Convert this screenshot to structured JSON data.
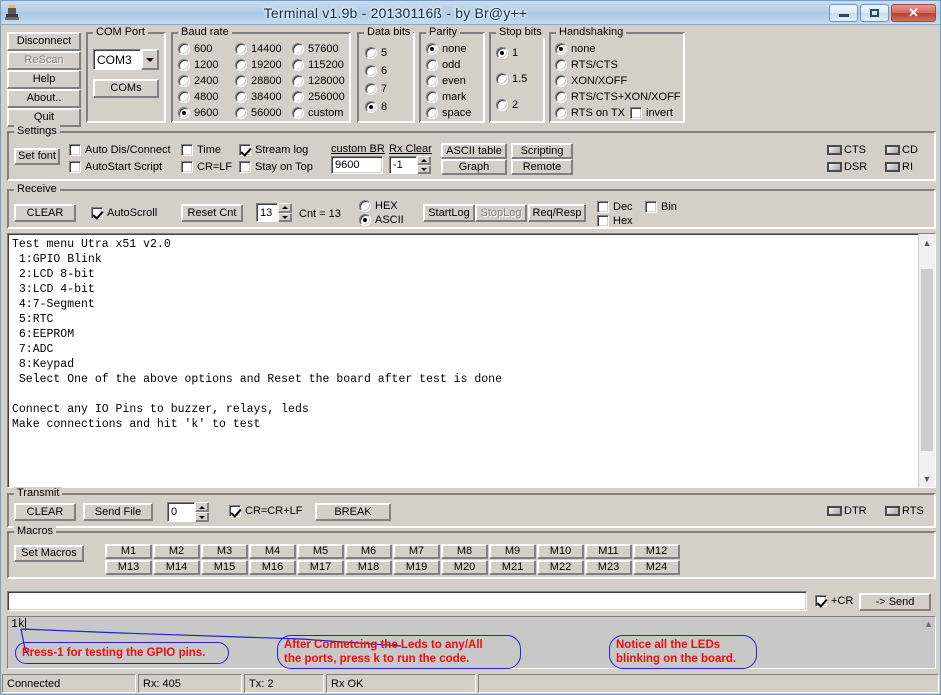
{
  "window": {
    "title": "Terminal v1.9b - 20130116ß - by Br@y++",
    "icon": "terminal-app-icon",
    "minimize_label": "Minimize",
    "maximize_label": "Maximize",
    "close_label": "Close"
  },
  "connection_buttons": [
    {
      "label": "Disconnect",
      "accel": "",
      "disabled": false
    },
    {
      "label": "ReScan",
      "accel": "R",
      "disabled": true
    },
    {
      "label": "Help",
      "accel": "H",
      "disabled": false
    },
    {
      "label": "About..",
      "accel": "A",
      "disabled": false
    },
    {
      "label": "Quit",
      "accel": "Q",
      "disabled": false
    }
  ],
  "com_port": {
    "legend": "COM Port",
    "selected": "COM3",
    "coms_button": "COMs"
  },
  "baud_rate": {
    "legend": "Baud rate",
    "selected": "9600",
    "col1": [
      "600",
      "1200",
      "2400",
      "4800",
      "9600"
    ],
    "col2": [
      "14400",
      "19200",
      "28800",
      "38400",
      "56000"
    ],
    "col3": [
      "57600",
      "115200",
      "128000",
      "256000",
      "custom"
    ]
  },
  "data_bits": {
    "legend": "Data bits",
    "selected": "8",
    "options": [
      "5",
      "6",
      "7",
      "8"
    ]
  },
  "parity": {
    "legend": "Parity",
    "selected": "none",
    "options": [
      "none",
      "odd",
      "even",
      "mark",
      "space"
    ]
  },
  "stop_bits": {
    "legend": "Stop bits",
    "selected": "1",
    "options": [
      "1",
      "1.5",
      "2"
    ]
  },
  "handshaking": {
    "legend": "Handshaking",
    "selected": "none",
    "options": [
      "none",
      "RTS/CTS",
      "XON/XOFF",
      "RTS/CTS+XON/XOFF",
      "RTS on TX"
    ],
    "invert_label": "invert",
    "invert_checked": false
  },
  "settings": {
    "legend": "Settings",
    "set_font_button": "Set font",
    "checks": [
      {
        "label": "Auto Dis/Connect",
        "checked": false
      },
      {
        "label": "AutoStart Script",
        "checked": false
      },
      {
        "label": "Time",
        "checked": false
      },
      {
        "label": "CR=LF",
        "checked": false
      },
      {
        "label": "Stream log",
        "checked": true
      },
      {
        "label": "Stay on Top",
        "checked": false
      }
    ],
    "custom_br_label": "custom BR",
    "custom_br_value": "9600",
    "rx_clear_label": "Rx Clear",
    "rx_clear_value": "-1",
    "ascii_table_button": "ASCII table",
    "graph_button": "Graph",
    "scripting_button": "Scripting",
    "remote_button": "Remote",
    "leds": [
      "CTS",
      "CD",
      "DSR",
      "RI"
    ]
  },
  "receive": {
    "legend": "Receive",
    "clear_button": "CLEAR",
    "autoscroll_label": "AutoScroll",
    "autoscroll_checked": true,
    "reset_cnt_button": "Reset Cnt",
    "cnt_spin_value": "13",
    "cnt_label": "Cnt = 13",
    "hex_label": "HEX",
    "ascii_label": "ASCII",
    "mode_selected": "ASCII",
    "startlog_button": "StartLog",
    "stoplog_button": "StopLog",
    "stoplog_disabled": true,
    "reqresp_button": "Req/Resp",
    "dec_label": "Dec",
    "hex_check_label": "Hex",
    "bin_label": "Bin",
    "dec_checked": false,
    "hex_checked": false,
    "bin_checked": false,
    "terminal_text": "Test menu Utra x51 v2.0\n 1:GPIO Blink\n 2:LCD 8-bit\n 3:LCD 4-bit\n 4:7-Segment\n 5:RTC\n 6:EEPROM\n 7:ADC\n 8:Keypad\n Select One of the above options and Reset the board after test is done\n\nConnect any IO Pins to buzzer, relays, leds\nMake connections and hit 'k' to test"
  },
  "transmit": {
    "legend": "Transmit",
    "clear_button": "CLEAR",
    "send_file_button": "Send File",
    "delay_value": "0",
    "crlf_label": "CR=CR+LF",
    "crlf_checked": true,
    "break_button": "BREAK",
    "leds": [
      "DTR",
      "RTS"
    ]
  },
  "macros": {
    "legend": "Macros",
    "set_macros_button": "Set Macros",
    "row1": [
      "M1",
      "M2",
      "M3",
      "M4",
      "M5",
      "M6",
      "M7",
      "M8",
      "M9",
      "M10",
      "M11",
      "M12"
    ],
    "row2": [
      "M13",
      "M14",
      "M15",
      "M16",
      "M17",
      "M18",
      "M19",
      "M20",
      "M21",
      "M22",
      "M23",
      "M24"
    ]
  },
  "send_bar": {
    "input_value": "",
    "input_placeholder": "",
    "cr_label": "+CR",
    "cr_checked": true,
    "send_button": "-> Send"
  },
  "transmit_log": {
    "text": "1k"
  },
  "annotations": [
    {
      "text": "Press-1 for testing the GPIO pins.",
      "color": "#e8100f"
    },
    {
      "text": "After Connetcing the Leds to any/All\nthe ports, press k to run the code.",
      "color": "#e8100f"
    },
    {
      "text": "Notice all the LEDs\nblinking on the board.",
      "color": "#e8100f"
    }
  ],
  "status_bar": {
    "connection": "Connected",
    "rx": "Rx: 405",
    "tx": "Tx: 2",
    "rx_state": "Rx OK",
    "extra": ""
  },
  "colors": {
    "face": "#d4d0c8",
    "annotation_text": "#e8100f",
    "annotation_outline": "#2323c8",
    "title_gradient_top": "#c9dcef",
    "close_button": "#b8402f"
  }
}
